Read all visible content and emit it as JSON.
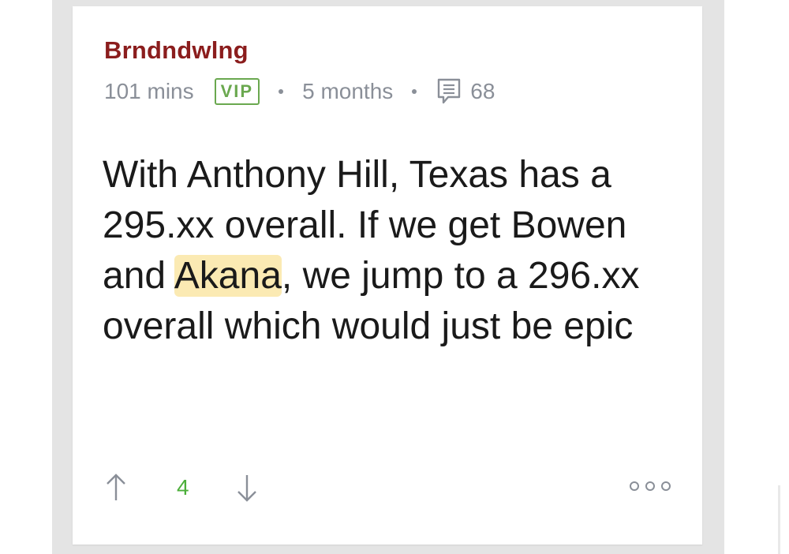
{
  "post": {
    "username": "Brndndwlng",
    "time_online": "101 mins",
    "badge": "VIP",
    "age": "5 months",
    "comment_count": "68",
    "body_before": "With Anthony Hill, Texas has a 295.xx overall. If we get Bowen and ",
    "body_highlight": "Akana",
    "body_after": ", we jump to a 296.xx overall which would just be epic",
    "score": "4",
    "icons": {
      "comment": "comment-icon",
      "upvote": "arrow-up-icon",
      "downvote": "arrow-down-icon",
      "more": "more-options-icon"
    },
    "colors": {
      "username": "#8b1d1d",
      "vip": "#6aa84f",
      "score": "#4caf3a",
      "highlight": "#fbeab3",
      "meta": "#8a8f98"
    }
  }
}
